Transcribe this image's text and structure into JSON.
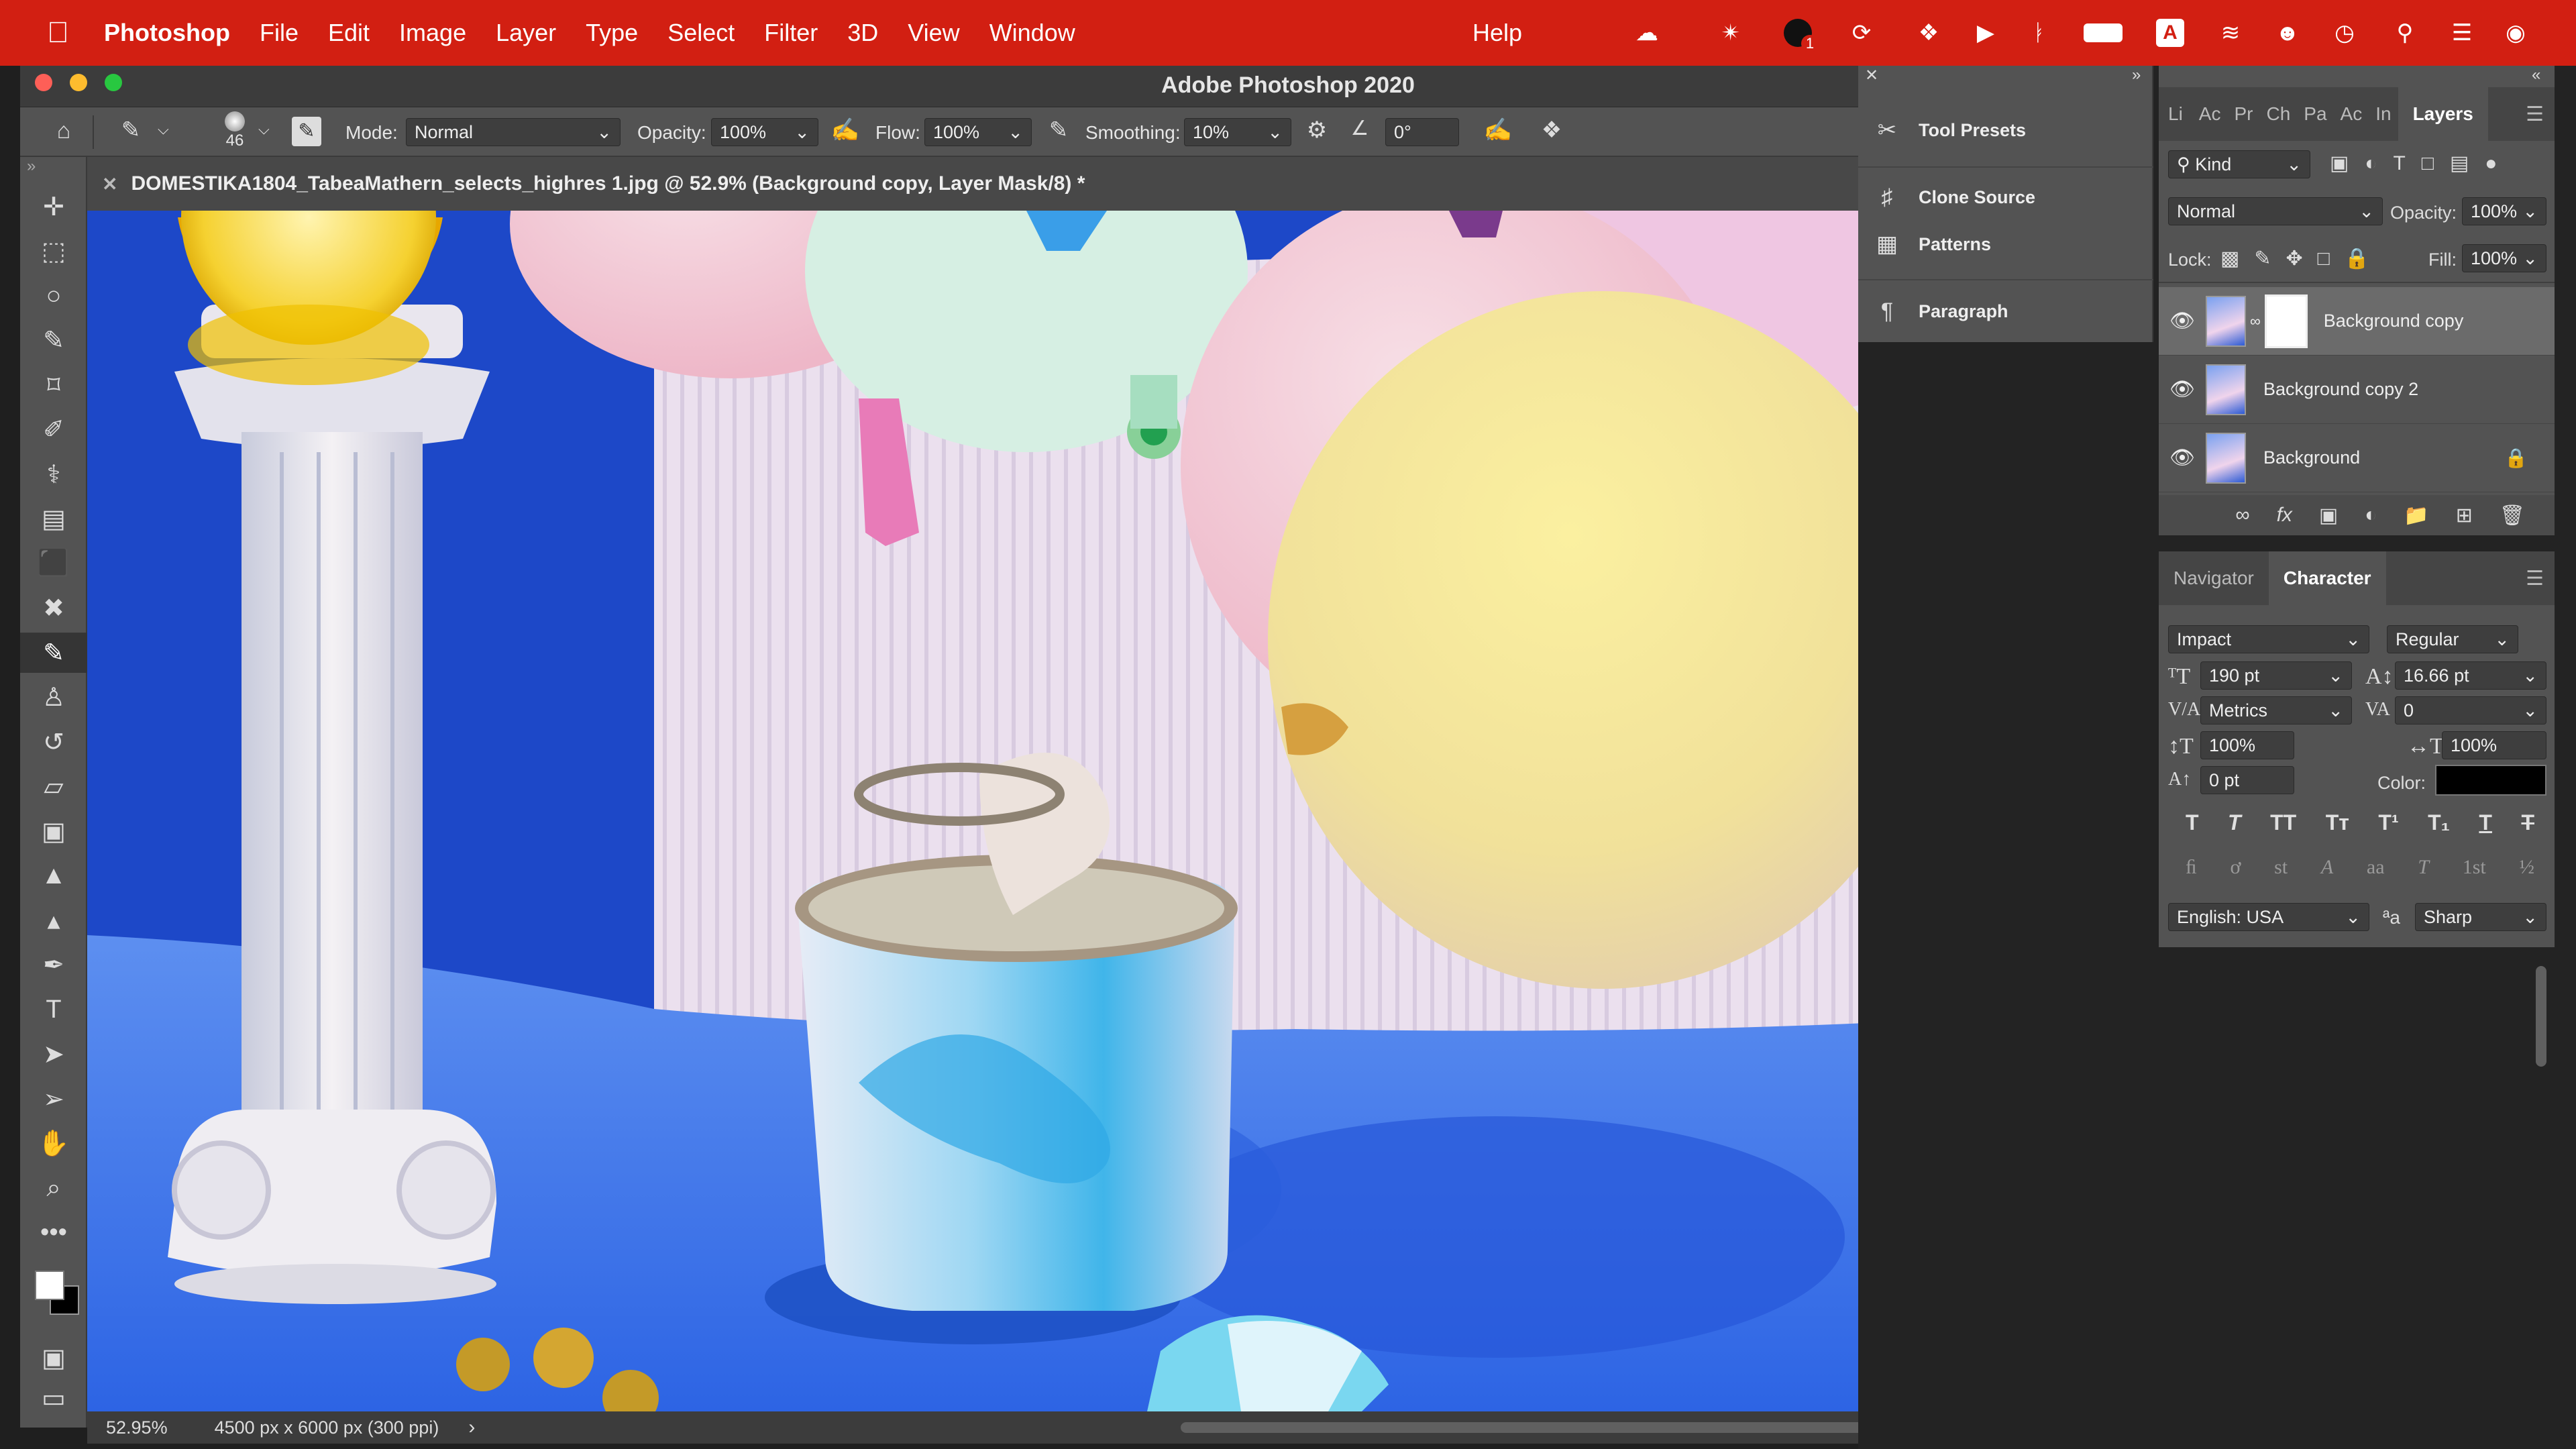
{
  "menubar": {
    "app_name": "Photoshop",
    "items": [
      "File",
      "Edit",
      "Image",
      "Layer",
      "Type",
      "Select",
      "Filter",
      "3D",
      "View",
      "Window"
    ],
    "help": "Help",
    "tray_icons": [
      "cloud-upload-icon",
      "creative-cloud-icon",
      "notification-icon",
      "sync-icon",
      "dropbox-icon",
      "play-icon",
      "bluetooth-icon",
      "battery-icon",
      "input-source-icon",
      "wifi-off-icon",
      "user-icon",
      "time-machine-icon",
      "search-icon",
      "control-center-icon",
      "siri-icon"
    ],
    "notification_badge": "1",
    "input_source_label": "A",
    "bg_color": "#d21f12"
  },
  "window": {
    "title": "Adobe Photoshop 2020"
  },
  "options_bar": {
    "brush_size": "46",
    "mode_label": "Mode:",
    "mode_value": "Normal",
    "opacity_label": "Opacity:",
    "opacity_value": "100%",
    "flow_label": "Flow:",
    "flow_value": "100%",
    "smoothing_label": "Smoothing:",
    "smoothing_value": "10%",
    "angle_value": "0°"
  },
  "document": {
    "tab_title": "DOMESTIKA1804_TabeaMathern_selects_highres 1.jpg @ 52.9% (Background copy, Layer Mask/8) *",
    "zoom": "52.95%",
    "dimensions": "4500 px x 6000 px (300 ppi)"
  },
  "toolbar": {
    "tools": [
      "move-tool-icon",
      "marquee-tool-icon",
      "lasso-tool-icon",
      "quick-select-tool-icon",
      "crop-tool-icon",
      "eyedropper-tool-icon",
      "spot-healing-tool-icon",
      "patch-tool-icon",
      "frame-tool-icon",
      "transform-tool-icon",
      "brush-tool-icon",
      "clone-stamp-tool-icon",
      "history-brush-tool-icon",
      "eraser-tool-icon",
      "gradient-tool-icon",
      "blur-tool-icon",
      "dodge-tool-icon",
      "pen-tool-icon",
      "type-tool-icon",
      "path-select-tool-icon",
      "direct-select-tool-icon",
      "hand-tool-icon",
      "zoom-tool-icon",
      "more-tools-icon"
    ],
    "foreground_color": "#ffffff",
    "background_color": "#000000"
  },
  "floating_panel": {
    "items": [
      "Tool Presets",
      "Clone Source",
      "Patterns",
      "Paragraph"
    ]
  },
  "layers_panel": {
    "tabs": [
      "Li",
      "Ac",
      "Pr",
      "Ch",
      "Pa",
      "Ac",
      "In",
      "Layers"
    ],
    "active_tab": "Layers",
    "kind_filter": "Kind",
    "blend_mode": "Normal",
    "opacity_label": "Opacity:",
    "opacity_value": "100%",
    "lock_label": "Lock:",
    "fill_label": "Fill:",
    "fill_value": "100%",
    "layers": [
      {
        "name": "Background copy",
        "has_mask": true,
        "selected": true
      },
      {
        "name": "Background copy 2",
        "has_mask": false,
        "selected": false
      },
      {
        "name": "Background",
        "has_mask": false,
        "selected": false,
        "locked": true
      }
    ]
  },
  "character_panel": {
    "tabs": [
      "Navigator",
      "Character"
    ],
    "active_tab": "Character",
    "font_family": "Impact",
    "font_style": "Regular",
    "font_size": "190 pt",
    "leading": "16.66 pt",
    "kerning": "Metrics",
    "tracking": "0",
    "vertical_scale": "100%",
    "horizontal_scale": "100%",
    "baseline_shift": "0 pt",
    "color_label": "Color:",
    "color_value": "#000000",
    "language": "English: USA",
    "antialias": "Sharp",
    "aa_symbol": "ªa",
    "format_buttons": [
      "T",
      "T",
      "TT",
      "Tт",
      "T¹",
      "T₁",
      "T",
      "T"
    ],
    "opentype_buttons": [
      "ﬁ",
      "ơ",
      "st",
      "A",
      "aa",
      "T",
      "1st",
      "½"
    ]
  },
  "domestika_logo": {
    "color": "#e01a1a"
  }
}
